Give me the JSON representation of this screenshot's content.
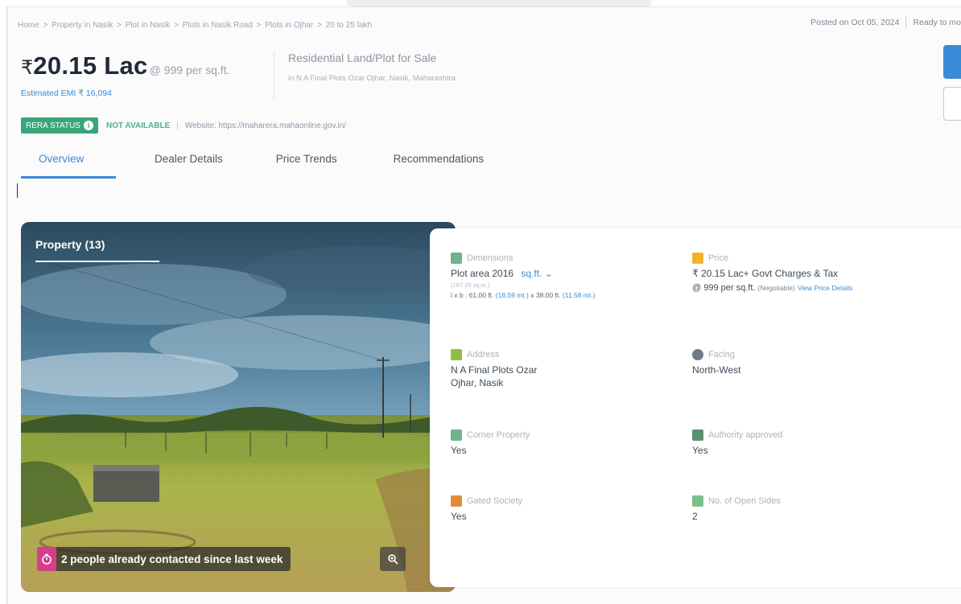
{
  "breadcrumb": [
    "Home",
    ">",
    "Property in Nasik",
    ">",
    "Plot in Nasik",
    ">",
    "Plots in Nasik Road",
    ">",
    "Plots in Ojhar",
    ">",
    "20 to 25 lakh"
  ],
  "header": {
    "posted": "Posted on Oct 05, 2024",
    "ready": "Ready to mo"
  },
  "price": {
    "rupee": "₹",
    "amount": "20.15 Lac",
    "rate": "@ 999 per sq.ft.",
    "emi": "Estimated EMI ₹ 16,094"
  },
  "property": {
    "type": "Residential Land/Plot for Sale",
    "location": "in N A Final Plots Ozar Ojhar, Nasik, Maharashtra"
  },
  "rera": {
    "badge": "RERA STATUS",
    "status": "NOT AVAILABLE",
    "separator": "|",
    "website": "Website: https://maharera.mahaonline.gov.in/"
  },
  "tabs": [
    "Overview",
    "Dealer Details",
    "Price Trends",
    "Recommendations"
  ],
  "photo": {
    "title": "Property (13)",
    "contact": "2 people already contacted since last week"
  },
  "details": {
    "dimensions": {
      "label": "Dimensions",
      "value": "Plot area 2016",
      "unit": "sq.ft.",
      "sub": "(187.29 sq.m.)",
      "lxb_prefix": "l x b : 61.00 ft.",
      "lxb_m1": "(18.59 mt.)",
      "lxb_mid": "x 38.00 ft.",
      "lxb_m2": "(11.58 mt.)"
    },
    "price": {
      "label": "Price",
      "value": "₹ 20.15 Lac+ Govt Charges & Tax",
      "rate": "@ 999 per sq.ft.",
      "negotiable": "(Negotiable)",
      "link": "View Price Details"
    },
    "address": {
      "label": "Address",
      "line1": "N A Final Plots Ozar",
      "line2": "Ojhar, Nasik"
    },
    "facing": {
      "label": "Facing",
      "value": "North-West"
    },
    "corner": {
      "label": "Corner Property",
      "value": "Yes"
    },
    "authority": {
      "label": "Authority approved",
      "value": "Yes"
    },
    "gated": {
      "label": "Gated Society",
      "value": "Yes"
    },
    "open_sides": {
      "label": "No. of Open Sides",
      "value": "2"
    }
  },
  "colors": {
    "accent": "#3a8bd6",
    "rera_green": "#3ba57a",
    "contact_pink": "#d63e8a"
  },
  "icons": [
    "info-icon",
    "timer-icon",
    "zoom-icon",
    "dimensions-icon",
    "price-icon",
    "address-icon",
    "facing-icon",
    "corner-icon",
    "authority-icon",
    "gated-icon",
    "open-sides-icon",
    "chevron-down-icon"
  ]
}
